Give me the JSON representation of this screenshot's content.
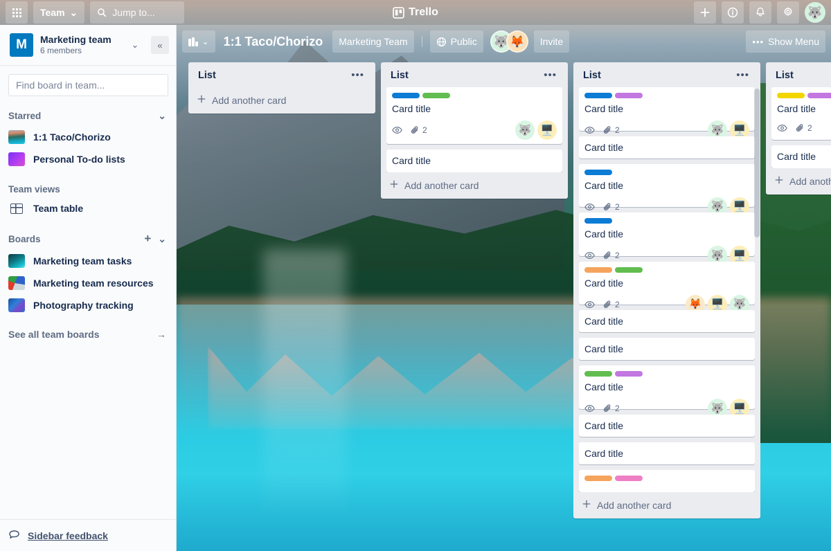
{
  "topnav": {
    "apps_icon": "grid-apps-icon",
    "team_button": {
      "label": "Team",
      "chevron": "⌄"
    },
    "search": {
      "icon": "search-icon",
      "placeholder": "Jump to...",
      "value": "Jump to..."
    },
    "brand": {
      "icon": "trello-logo-icon",
      "label": "Trello"
    },
    "actions": [
      {
        "name": "add-button",
        "glyph": "+"
      },
      {
        "name": "info-button",
        "glyph": "i"
      },
      {
        "name": "notifications-button",
        "glyph": "bell"
      },
      {
        "name": "settings-button",
        "glyph": "gear"
      }
    ],
    "user_avatar": {
      "emoji": "🐺",
      "bg": "#d6f2e0"
    }
  },
  "sidebar": {
    "team": {
      "initial": "M",
      "name": "Marketing team",
      "members": "6 members",
      "avatar_bg": "#0079bf"
    },
    "chevron": "⌄",
    "collapse": "«",
    "search": {
      "placeholder": "Find board in team...",
      "value": ""
    },
    "starred": {
      "title": "Starred",
      "chevron": "⌄"
    },
    "starred_items": [
      {
        "label": "1:1 Taco/Chorizo",
        "thumb": "thumb-lake"
      },
      {
        "label": "Personal To-do lists",
        "thumb": "thumb-purple"
      }
    ],
    "team_views": {
      "title": "Team views"
    },
    "team_views_items": [
      {
        "label": "Team table",
        "icon": "table-icon"
      }
    ],
    "boards": {
      "title": "Boards",
      "add": "+",
      "chevron": "⌄"
    },
    "boards_items": [
      {
        "label": "Marketing team tasks",
        "thumb": "thumb-teal"
      },
      {
        "label": "Marketing team resources",
        "thumb": "thumb-multi"
      },
      {
        "label": "Photography tracking",
        "thumb": "thumb-blue"
      }
    ],
    "see_all": {
      "label": "See all team boards",
      "arrow": "→"
    },
    "feedback": {
      "icon": "comment-icon",
      "label": "Sidebar feedback"
    }
  },
  "board_header": {
    "switcher": {
      "icon": "board-switcher-icon",
      "chevron": "⌄"
    },
    "title": "1:1 Taco/Chorizo",
    "team_badge": "Marketing Team",
    "visibility": {
      "icon": "globe-icon",
      "label": "Public"
    },
    "members": [
      {
        "emoji": "🐺",
        "bg": "#d6f2e0"
      },
      {
        "emoji": "🦊",
        "bg": "#fbe0b8"
      }
    ],
    "invite_label": "Invite",
    "show_menu": {
      "dots": "•••",
      "label": "Show Menu"
    }
  },
  "labels": {
    "blue": "#0c7cd5",
    "green": "#61bd4f",
    "purple": "#c377e0",
    "orange": "#f5a45d",
    "yellow": "#f2d600",
    "pink": "#ef7fc4"
  },
  "badges": {
    "watch_icon": "eye-icon",
    "attachment_icon": "paperclip-icon",
    "attachment_count": "2"
  },
  "lists": [
    {
      "title": "List",
      "menu": "•••",
      "footer": "Add another card",
      "cards": []
    },
    {
      "title": "List",
      "menu": "•••",
      "footer": "Add another card",
      "cards": [
        {
          "title": "Card title",
          "labels": [
            "blue",
            "green"
          ],
          "watch": true,
          "attachments": "2",
          "members": [
            {
              "emoji": "🐺",
              "bg": "av-mint"
            },
            {
              "emoji": "🖥️",
              "bg": "av-yellow"
            }
          ]
        },
        {
          "title": "Card title",
          "labels": [],
          "watch": false,
          "attachments": "",
          "members": []
        }
      ]
    },
    {
      "title": "List",
      "menu": "•••",
      "footer": "Add another card",
      "scroll": true,
      "cards": [
        {
          "title": "Card title",
          "labels": [
            "blue",
            "purple"
          ],
          "watch": true,
          "attachments": "2",
          "members": [
            {
              "emoji": "🐺",
              "bg": "av-mint"
            },
            {
              "emoji": "🖥️",
              "bg": "av-yellow"
            }
          ]
        },
        {
          "title": "Card title",
          "labels": [],
          "watch": false,
          "attachments": "",
          "members": []
        },
        {
          "title": "Card title",
          "labels": [
            "blue"
          ],
          "watch": true,
          "attachments": "2",
          "members": [
            {
              "emoji": "🐺",
              "bg": "av-mint"
            },
            {
              "emoji": "🖥️",
              "bg": "av-yellow"
            }
          ]
        },
        {
          "title": "Card title",
          "labels": [
            "blue"
          ],
          "watch": true,
          "attachments": "2",
          "members": [
            {
              "emoji": "🐺",
              "bg": "av-mint"
            },
            {
              "emoji": "🖥️",
              "bg": "av-yellow"
            }
          ]
        },
        {
          "title": "Card title",
          "labels": [
            "orange",
            "green"
          ],
          "watch": true,
          "attachments": "2",
          "members": [
            {
              "emoji": "🦊",
              "bg": "av-cream"
            },
            {
              "emoji": "🖥️",
              "bg": "av-yellow"
            },
            {
              "emoji": "🐺",
              "bg": "av-mint"
            }
          ]
        },
        {
          "title": "Card title",
          "labels": [],
          "watch": false,
          "attachments": "",
          "members": []
        },
        {
          "title": "Card title",
          "labels": [],
          "watch": false,
          "attachments": "",
          "members": []
        },
        {
          "title": "Card title",
          "labels": [
            "green",
            "purple"
          ],
          "watch": true,
          "attachments": "2",
          "members": [
            {
              "emoji": "🐺",
              "bg": "av-mint"
            },
            {
              "emoji": "🖥️",
              "bg": "av-yellow"
            }
          ]
        },
        {
          "title": "Card title",
          "labels": [],
          "watch": false,
          "attachments": "",
          "members": []
        },
        {
          "title": "Card title",
          "labels": [],
          "watch": false,
          "attachments": "",
          "members": []
        },
        {
          "title": "",
          "labels": [
            "orange",
            "pink"
          ],
          "watch": false,
          "attachments": "",
          "members": []
        }
      ]
    },
    {
      "title": "List",
      "menu": "",
      "footer": "Add another card",
      "clipped": true,
      "cards": [
        {
          "title": "Card title",
          "labels": [
            "yellow",
            "purple"
          ],
          "watch": true,
          "attachments": "2",
          "members": []
        },
        {
          "title": "Card title",
          "labels": [],
          "watch": false,
          "attachments": "",
          "members": []
        }
      ]
    }
  ]
}
